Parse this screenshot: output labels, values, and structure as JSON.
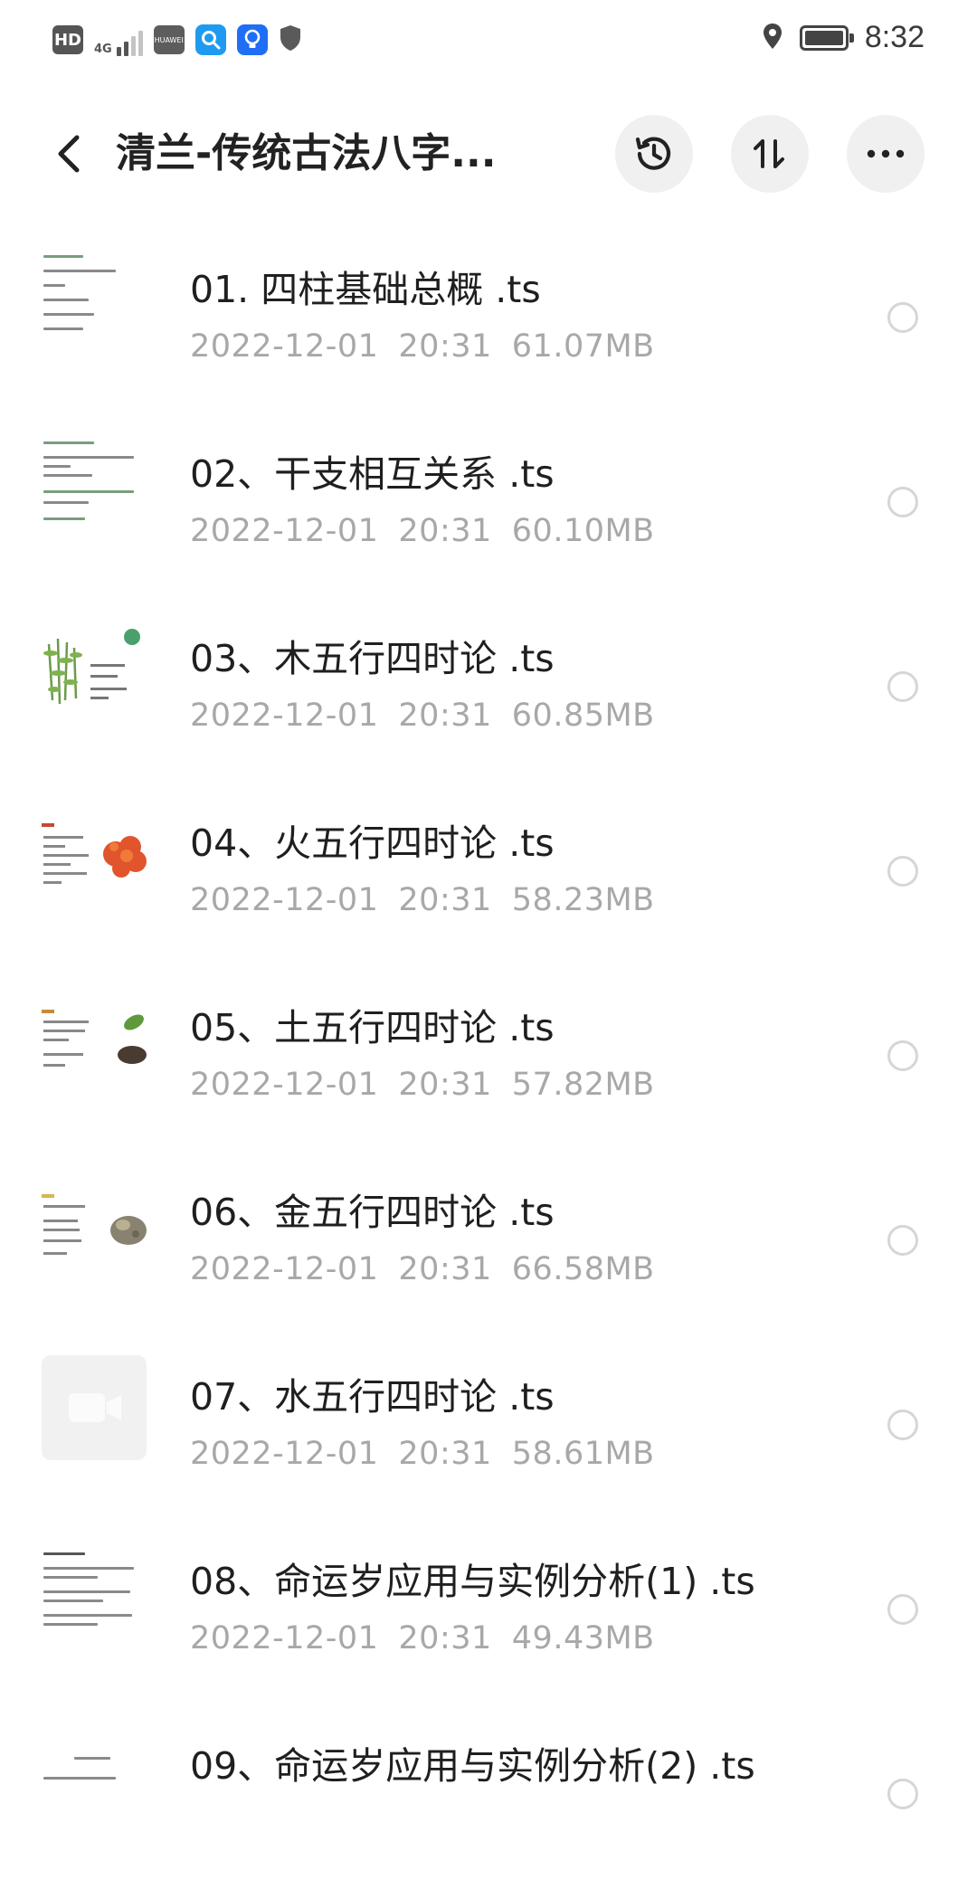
{
  "status_bar": {
    "hd_label": "HD",
    "network_label": "4G",
    "carrier_icon_text": "HUAWEI",
    "time": "8:32"
  },
  "header": {
    "title": "清兰-传统古法八字..."
  },
  "files": [
    {
      "name": "01. 四柱基础总概 .ts",
      "date": "2022-12-01",
      "time": "20:31",
      "size": "61.07MB",
      "thumb": "doc"
    },
    {
      "name": "02、干支相互关系 .ts",
      "date": "2022-12-01",
      "time": "20:31",
      "size": "60.10MB",
      "thumb": "doc-green"
    },
    {
      "name": "03、木五行四时论 .ts",
      "date": "2022-12-01",
      "time": "20:31",
      "size": "60.85MB",
      "thumb": "bamboo"
    },
    {
      "name": "04、火五行四时论 .ts",
      "date": "2022-12-01",
      "time": "20:31",
      "size": "58.23MB",
      "thumb": "fire"
    },
    {
      "name": "05、土五行四时论 .ts",
      "date": "2022-12-01",
      "time": "20:31",
      "size": "57.82MB",
      "thumb": "earth"
    },
    {
      "name": "06、金五行四时论 .ts",
      "date": "2022-12-01",
      "time": "20:31",
      "size": "66.58MB",
      "thumb": "metal"
    },
    {
      "name": "07、水五行四时论 .ts",
      "date": "2022-12-01",
      "time": "20:31",
      "size": "58.61MB",
      "thumb": "video"
    },
    {
      "name": "08、命运岁应用与实例分析(1) .ts",
      "date": "2022-12-01",
      "time": "20:31",
      "size": "49.43MB",
      "thumb": "doc"
    },
    {
      "name": "09、命运岁应用与实例分析(2) .ts",
      "date": "",
      "time": "",
      "size": "",
      "thumb": "doc"
    }
  ],
  "colors": {
    "title": "#222222",
    "meta": "#a8a8a8",
    "radio_border": "#d6d6d6",
    "button_bg": "#f0f0f0"
  },
  "icons": {
    "back": "back-arrow-icon",
    "history": "history-icon",
    "sort": "sort-icon",
    "more": "more-icon"
  }
}
